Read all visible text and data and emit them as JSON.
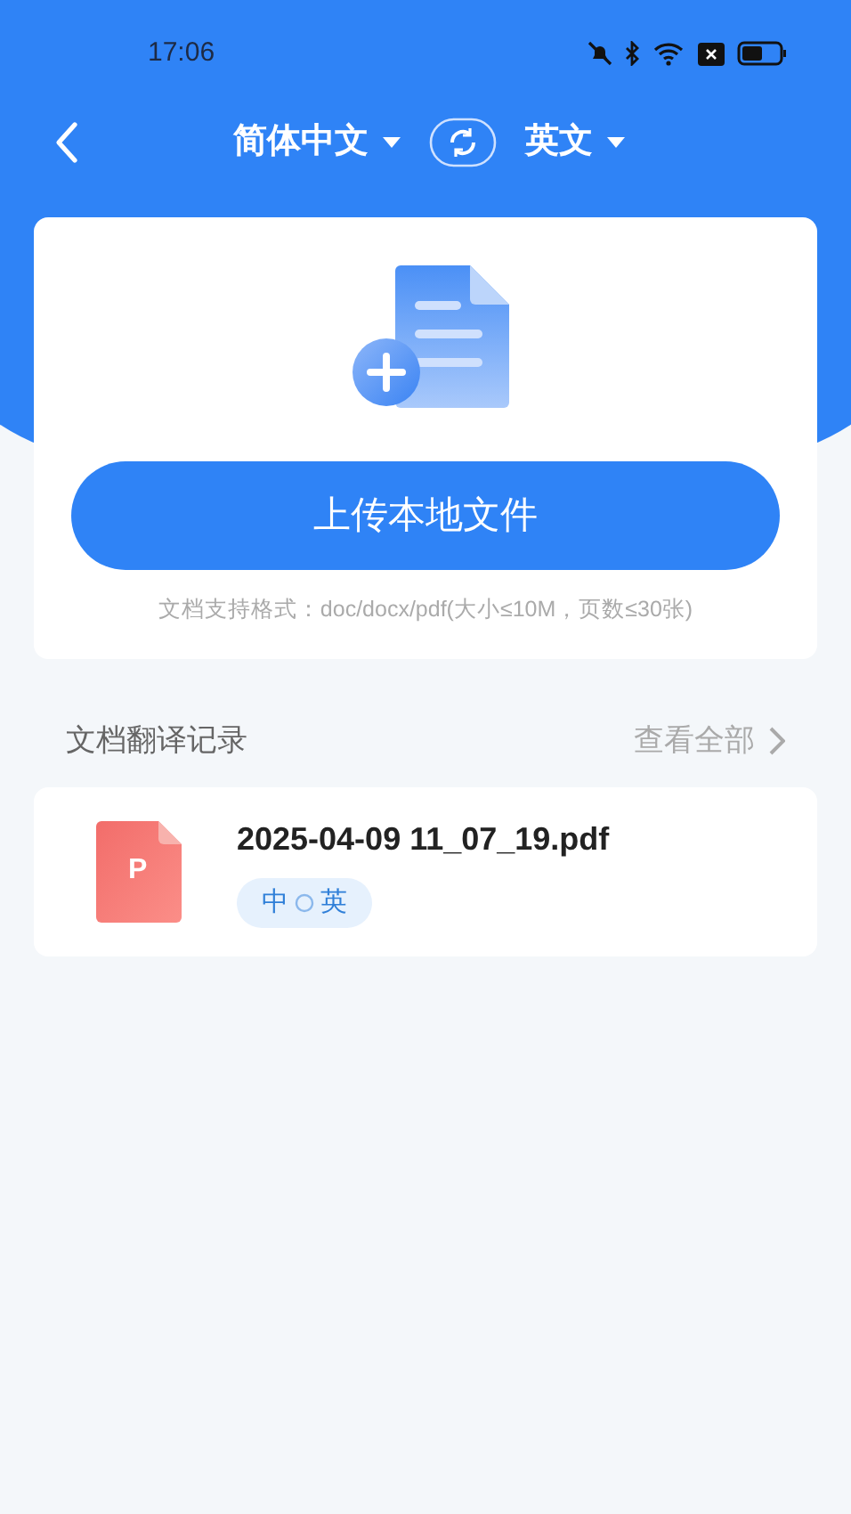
{
  "status_bar": {
    "time": "17:06"
  },
  "nav": {
    "source_language": "简体中文",
    "target_language": "英文"
  },
  "upload": {
    "button": "上传本地文件",
    "hint": "文档支持格式：doc/docx/pdf(大小≤10M，页数≤30张)"
  },
  "history": {
    "title": "文档翻译记录",
    "view_all": "查看全部",
    "records": [
      {
        "file_type": "P",
        "name": "2025-04-09 11_07_19.pdf",
        "source": "中",
        "target": "英"
      }
    ]
  }
}
